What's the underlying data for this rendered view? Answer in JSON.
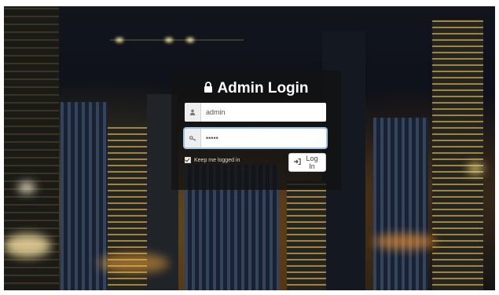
{
  "login": {
    "title": "Admin Login",
    "username_value": "admin",
    "password_value": "•••••",
    "remember_label": "Keep me logged in",
    "remember_checked": true,
    "submit_label": "Log In"
  },
  "icons": {
    "title": "lock-icon",
    "username": "user-icon",
    "password": "key-icon",
    "submit": "sign-in-icon"
  },
  "colors": {
    "panel_bg": "#121212",
    "title_text": "#ffffff",
    "field_focus": "#9ec3e6"
  }
}
